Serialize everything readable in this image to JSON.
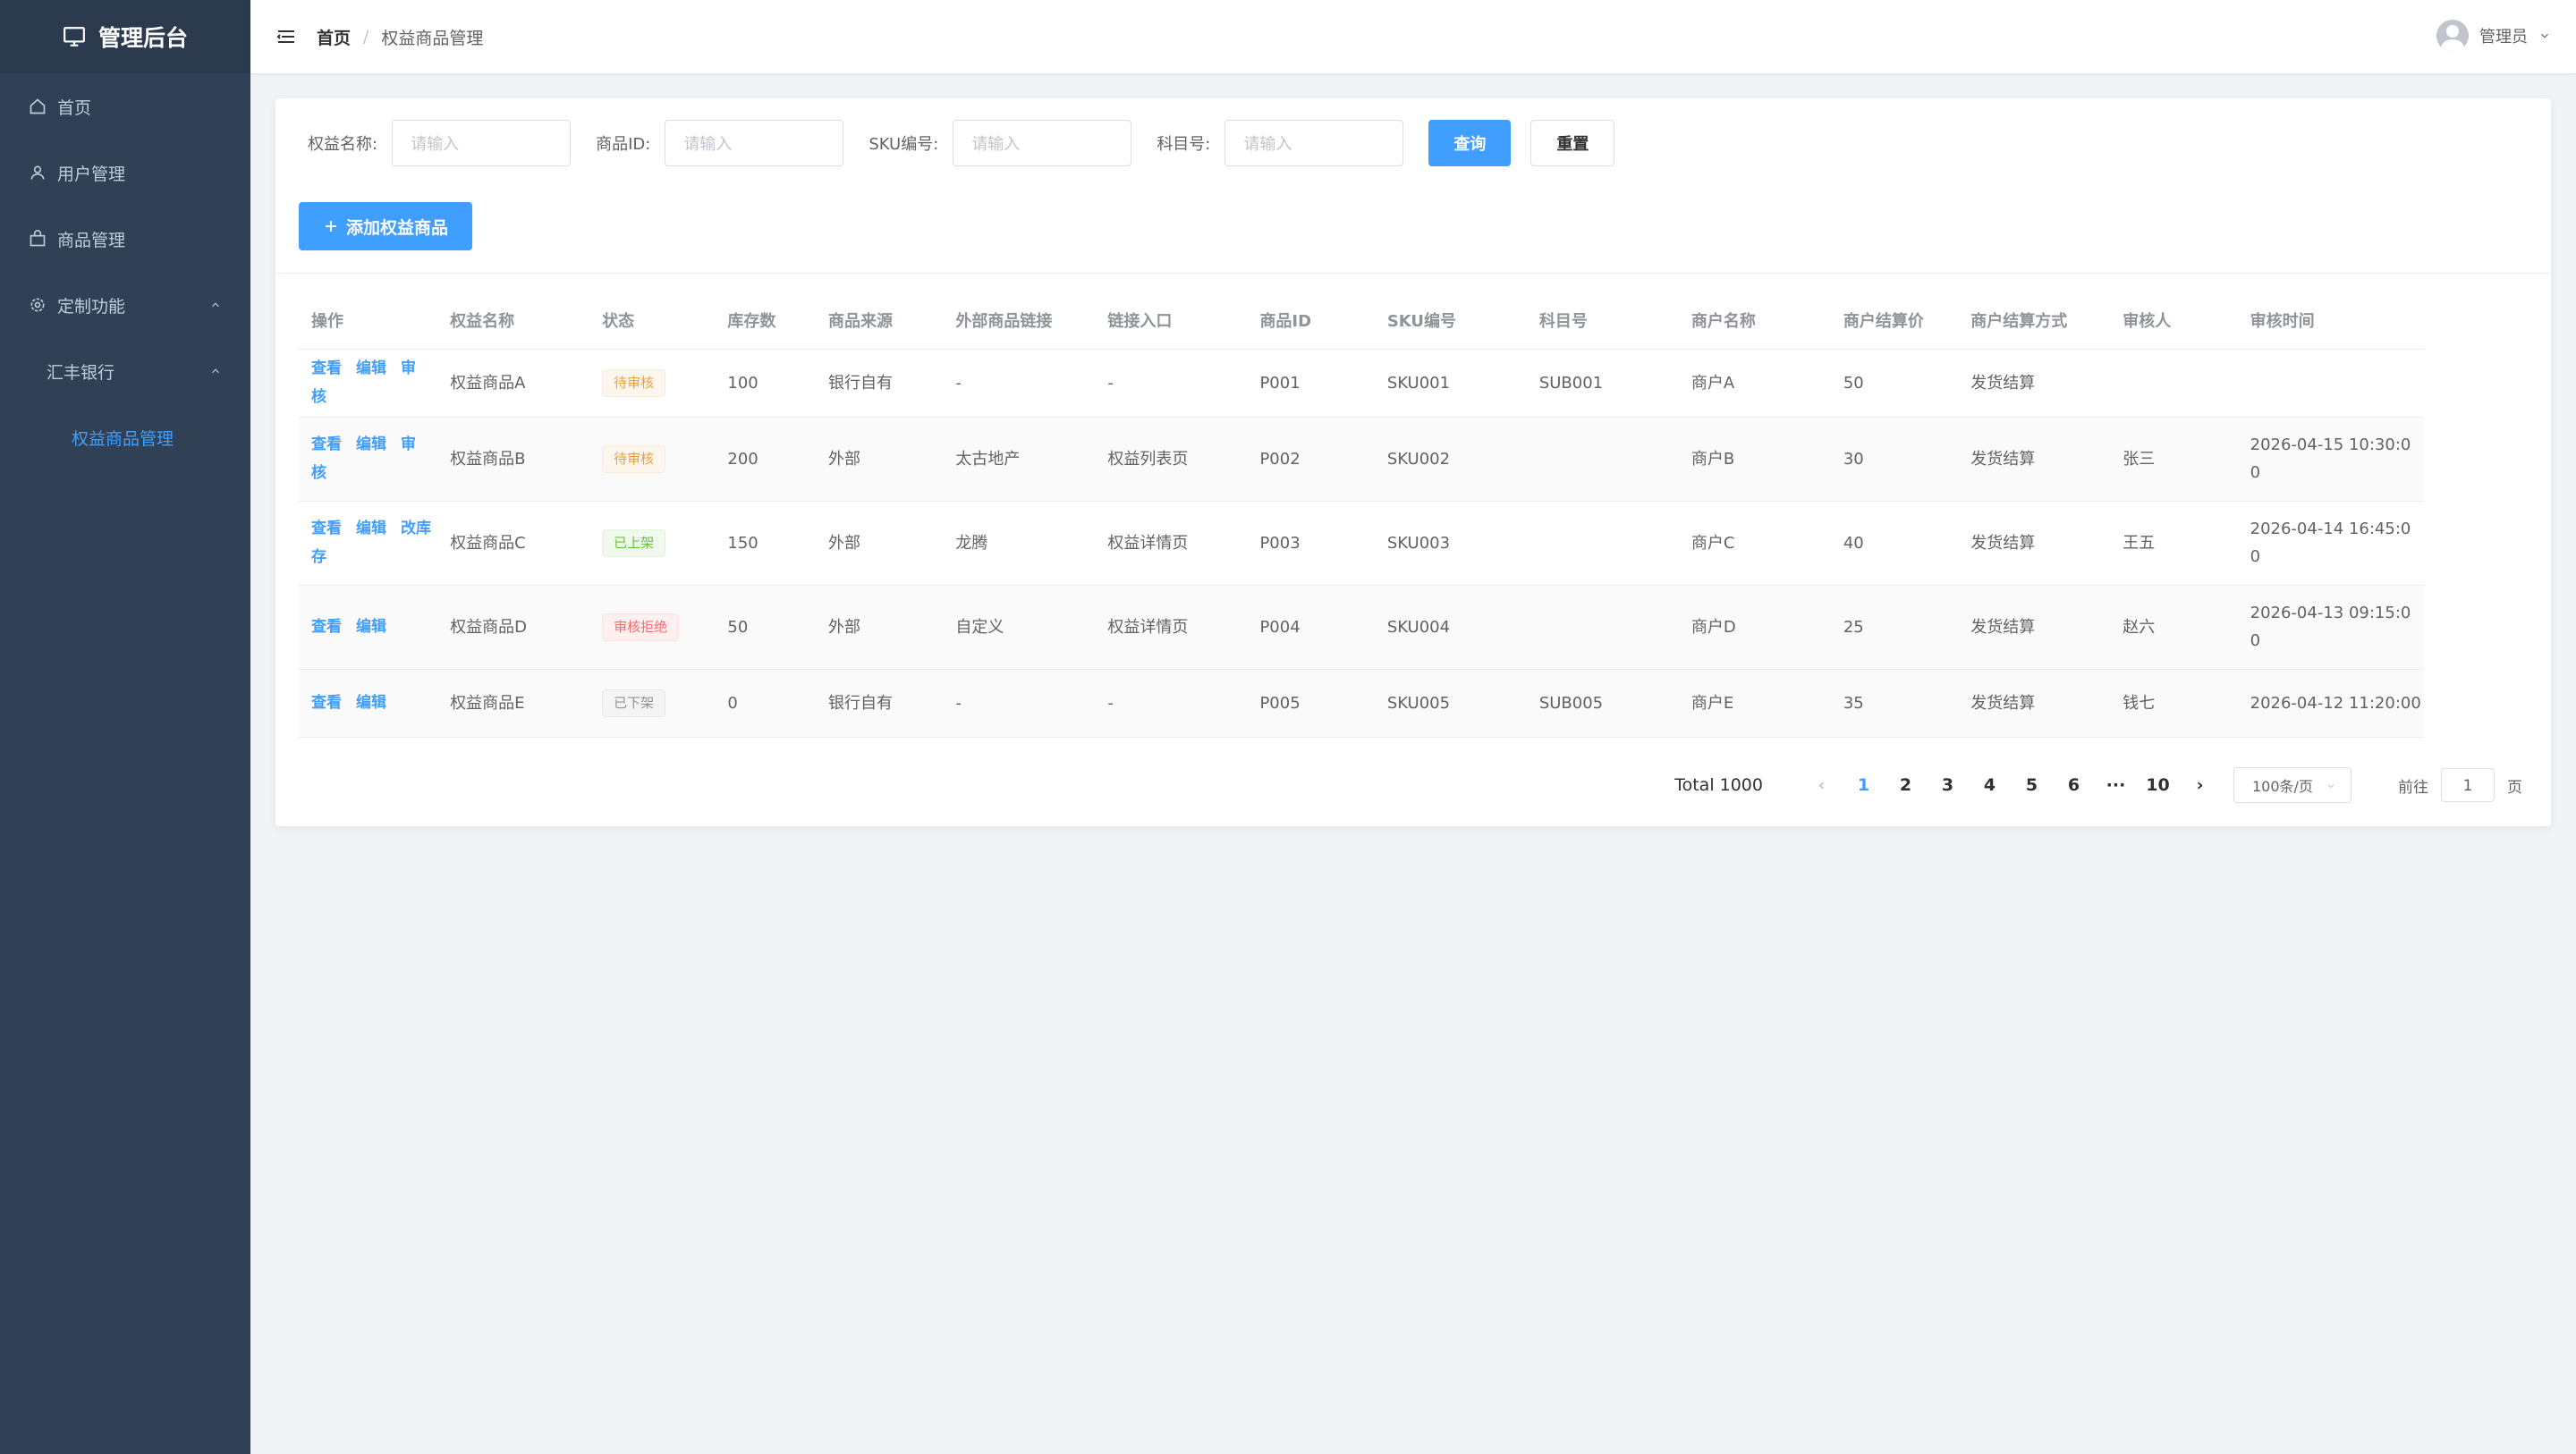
{
  "app": {
    "title": "管理后台"
  },
  "sidebar": {
    "items": [
      {
        "label": "首页",
        "icon": "home-icon"
      },
      {
        "label": "用户管理",
        "icon": "user-icon"
      },
      {
        "label": "商品管理",
        "icon": "bag-icon"
      },
      {
        "label": "定制功能",
        "icon": "gear-icon"
      },
      {
        "label": "汇丰银行"
      },
      {
        "label": "权益商品管理"
      }
    ]
  },
  "header": {
    "breadcrumb": {
      "home": "首页",
      "current": "权益商品管理"
    },
    "user": "管理员"
  },
  "search": {
    "fields": [
      {
        "label": "权益名称:",
        "placeholder": "请输入"
      },
      {
        "label": "商品ID:",
        "placeholder": "请输入"
      },
      {
        "label": "SKU编号:",
        "placeholder": "请输入"
      },
      {
        "label": "科目号:",
        "placeholder": "请输入"
      }
    ],
    "query_label": "查询",
    "reset_label": "重置"
  },
  "add_button": "添加权益商品",
  "table": {
    "columns": [
      "操作",
      "权益名称",
      "状态",
      "库存数",
      "商品来源",
      "外部商品链接",
      "链接入口",
      "商品ID",
      "SKU编号",
      "科目号",
      "商户名称",
      "商户结算价",
      "商户结算方式",
      "审核人",
      "审核时间"
    ],
    "rows": [
      {
        "actions": [
          "查看",
          "编辑",
          "审核"
        ],
        "name": "权益商品A",
        "status": "待审核",
        "stock": "100",
        "source": "银行自有",
        "ext_link": "-",
        "entry": "-",
        "pid": "P001",
        "sku": "SKU001",
        "subject": "SUB001",
        "merchant": "商户A",
        "price": "50",
        "settle": "发货结算",
        "reviewer": "",
        "time": ""
      },
      {
        "actions": [
          "查看",
          "编辑",
          "审核"
        ],
        "name": "权益商品B",
        "status": "待审核",
        "stock": "200",
        "source": "外部",
        "ext_link": "太古地产",
        "entry": "权益列表页",
        "pid": "P002",
        "sku": "SKU002",
        "subject": "",
        "merchant": "商户B",
        "price": "30",
        "settle": "发货结算",
        "reviewer": "张三",
        "time": "2026-04-15 10:30:0",
        "time2": "0"
      },
      {
        "actions": [
          "查看",
          "编辑",
          "改库存"
        ],
        "name": "权益商品C",
        "status": "已上架",
        "stock": "150",
        "source": "外部",
        "ext_link": "龙腾",
        "entry": "权益详情页",
        "pid": "P003",
        "sku": "SKU003",
        "subject": "",
        "merchant": "商户C",
        "price": "40",
        "settle": "发货结算",
        "reviewer": "王五",
        "time": "2026-04-14 16:45:0",
        "time2": "0"
      },
      {
        "actions": [
          "查看",
          "编辑"
        ],
        "name": "权益商品D",
        "status": "审核拒绝",
        "stock": "50",
        "source": "外部",
        "ext_link": "自定义",
        "entry": "权益详情页",
        "pid": "P004",
        "sku": "SKU004",
        "subject": "",
        "merchant": "商户D",
        "price": "25",
        "settle": "发货结算",
        "reviewer": "赵六",
        "time": "2026-04-13 09:15:0",
        "time2": "0"
      },
      {
        "actions": [
          "查看",
          "编辑"
        ],
        "name": "权益商品E",
        "status": "已下架",
        "stock": "0",
        "source": "银行自有",
        "ext_link": "-",
        "entry": "-",
        "pid": "P005",
        "sku": "SKU005",
        "subject": "SUB005",
        "merchant": "商户E",
        "price": "35",
        "settle": "发货结算",
        "reviewer": "钱七",
        "time": "2026-04-12 11:20:00"
      }
    ]
  },
  "pagination": {
    "total": "Total 1000",
    "pages": [
      "1",
      "2",
      "3",
      "4",
      "5",
      "6",
      "···",
      "10"
    ],
    "current": "1",
    "page_size": "100条/页",
    "goto_label": "前往",
    "goto_value": "1",
    "page_suffix": "页"
  },
  "colors": {
    "primary": "#409eff",
    "sidebar": "#304156",
    "warning": "#e6a23c",
    "success": "#67c23a",
    "danger": "#f56c6c",
    "info": "#909399"
  }
}
